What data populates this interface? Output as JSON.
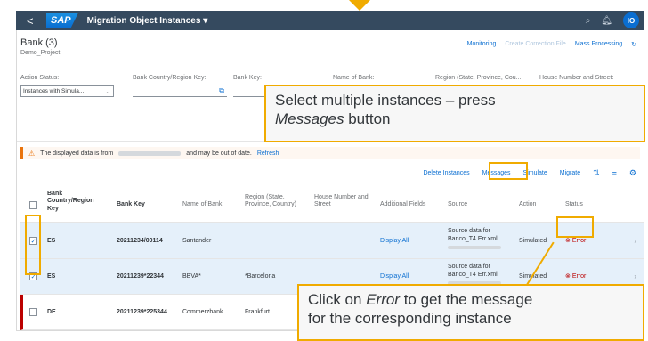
{
  "shell": {
    "back": "<",
    "logo": "SAP",
    "title": "Migration Object Instances ▾",
    "avatar": "IO"
  },
  "page": {
    "title": "Bank (3)",
    "subtitle": "Demo_Project"
  },
  "header_links": {
    "monitoring": "Monitoring",
    "create_correction": "Create Correction File",
    "mass_processing": "Mass Processing"
  },
  "filters": {
    "action_status": {
      "label": "Action Status:",
      "value": "Instances with Simula..."
    },
    "bank_country": {
      "label": "Bank Country/Region Key:"
    },
    "bank_key": {
      "label": "Bank Key:"
    },
    "name_of_bank": {
      "label": "Name of Bank:"
    },
    "region": {
      "label": "Region (State, Province, Cou..."
    },
    "house_number": {
      "label": "House Number and Street:"
    }
  },
  "banner": {
    "text_before": "The displayed data is from",
    "text_after": "and may be out of date.",
    "refresh": "Refresh"
  },
  "toolbar": {
    "delete": "Delete Instances",
    "messages": "Messages",
    "simulate": "Simulate",
    "migrate": "Migrate"
  },
  "table": {
    "headers": {
      "country": "Bank Country/Region Key",
      "bank_key": "Bank Key",
      "name": "Name of Bank",
      "region": "Region (State, Province, Country)",
      "house": "House Number and Street",
      "additional": "Additional Fields",
      "source": "Source",
      "action": "Action",
      "status": "Status"
    },
    "rows": [
      {
        "country": "ES",
        "bank_key": "20211234/00114",
        "name": "Santander",
        "region": "",
        "additional": "Display All",
        "source": "Source data for Banco_T4 Err.xml",
        "action": "Simulated",
        "status": "Error"
      },
      {
        "country": "ES",
        "bank_key": "20211239*22344",
        "name": "BBVA*",
        "region": "*Barcelona",
        "additional": "Display All",
        "source": "Source data for Banco_T4 Err.xml",
        "action": "Simulated",
        "status": "Error"
      },
      {
        "country": "DE",
        "bank_key": "20211239*225344",
        "name": "Commerzbank",
        "region": "Frankfurt",
        "additional": "",
        "source": "",
        "action": "",
        "status": ""
      }
    ]
  },
  "callouts": {
    "top": {
      "line1": "Select multiple instances – press",
      "italic": "Messages",
      "after": " button"
    },
    "bottom": {
      "prefix": "Click on ",
      "italic": "Error",
      "after": " to get the message",
      "line2": "for the corresponding instance"
    }
  },
  "colors": {
    "highlight": "#f0ab00",
    "shell": "#354a5f",
    "link": "#0a6ed1",
    "error": "#bb0000"
  }
}
